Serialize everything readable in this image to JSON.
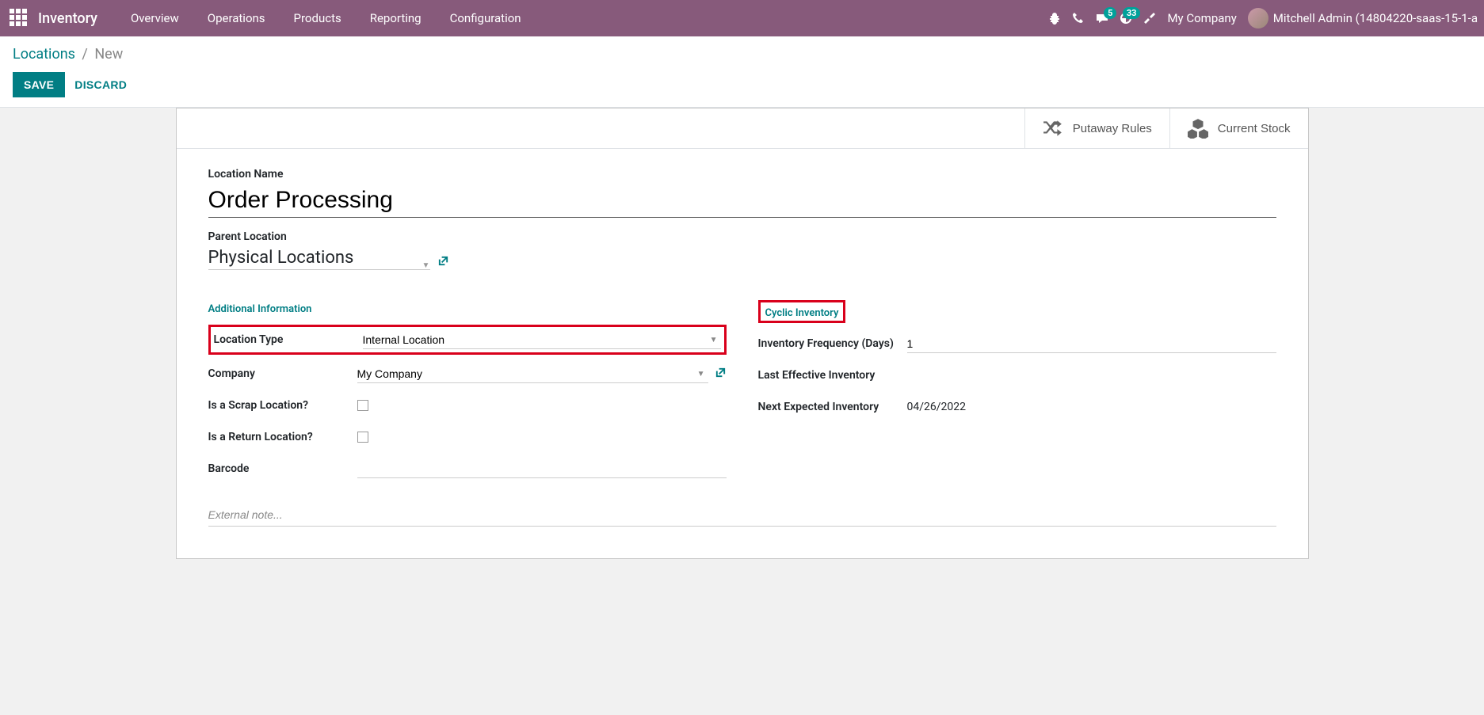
{
  "navbar": {
    "brand": "Inventory",
    "menu": [
      "Overview",
      "Operations",
      "Products",
      "Reporting",
      "Configuration"
    ],
    "msg_badge": "5",
    "activity_badge": "33",
    "company": "My Company",
    "user": "Mitchell Admin (14804220-saas-15-1-a"
  },
  "breadcrumb": {
    "parent": "Locations",
    "current": "New"
  },
  "buttons": {
    "save": "SAVE",
    "discard": "DISCARD"
  },
  "stat_buttons": {
    "putaway": "Putaway Rules",
    "stock": "Current Stock"
  },
  "form": {
    "name_label": "Location Name",
    "name_value": "Order Processing",
    "parent_label": "Parent Location",
    "parent_value": "Physical Locations"
  },
  "left": {
    "section": "Additional Information",
    "loc_type_label": "Location Type",
    "loc_type_value": "Internal Location",
    "company_label": "Company",
    "company_value": "My Company",
    "scrap_label": "Is a Scrap Location?",
    "return_label": "Is a Return Location?",
    "barcode_label": "Barcode",
    "barcode_value": ""
  },
  "right": {
    "section": "Cyclic Inventory",
    "freq_label": "Inventory Frequency (Days)",
    "freq_value": "1",
    "last_label": "Last Effective Inventory",
    "last_value": "",
    "next_label": "Next Expected Inventory",
    "next_value": "04/26/2022"
  },
  "note_placeholder": "External note..."
}
